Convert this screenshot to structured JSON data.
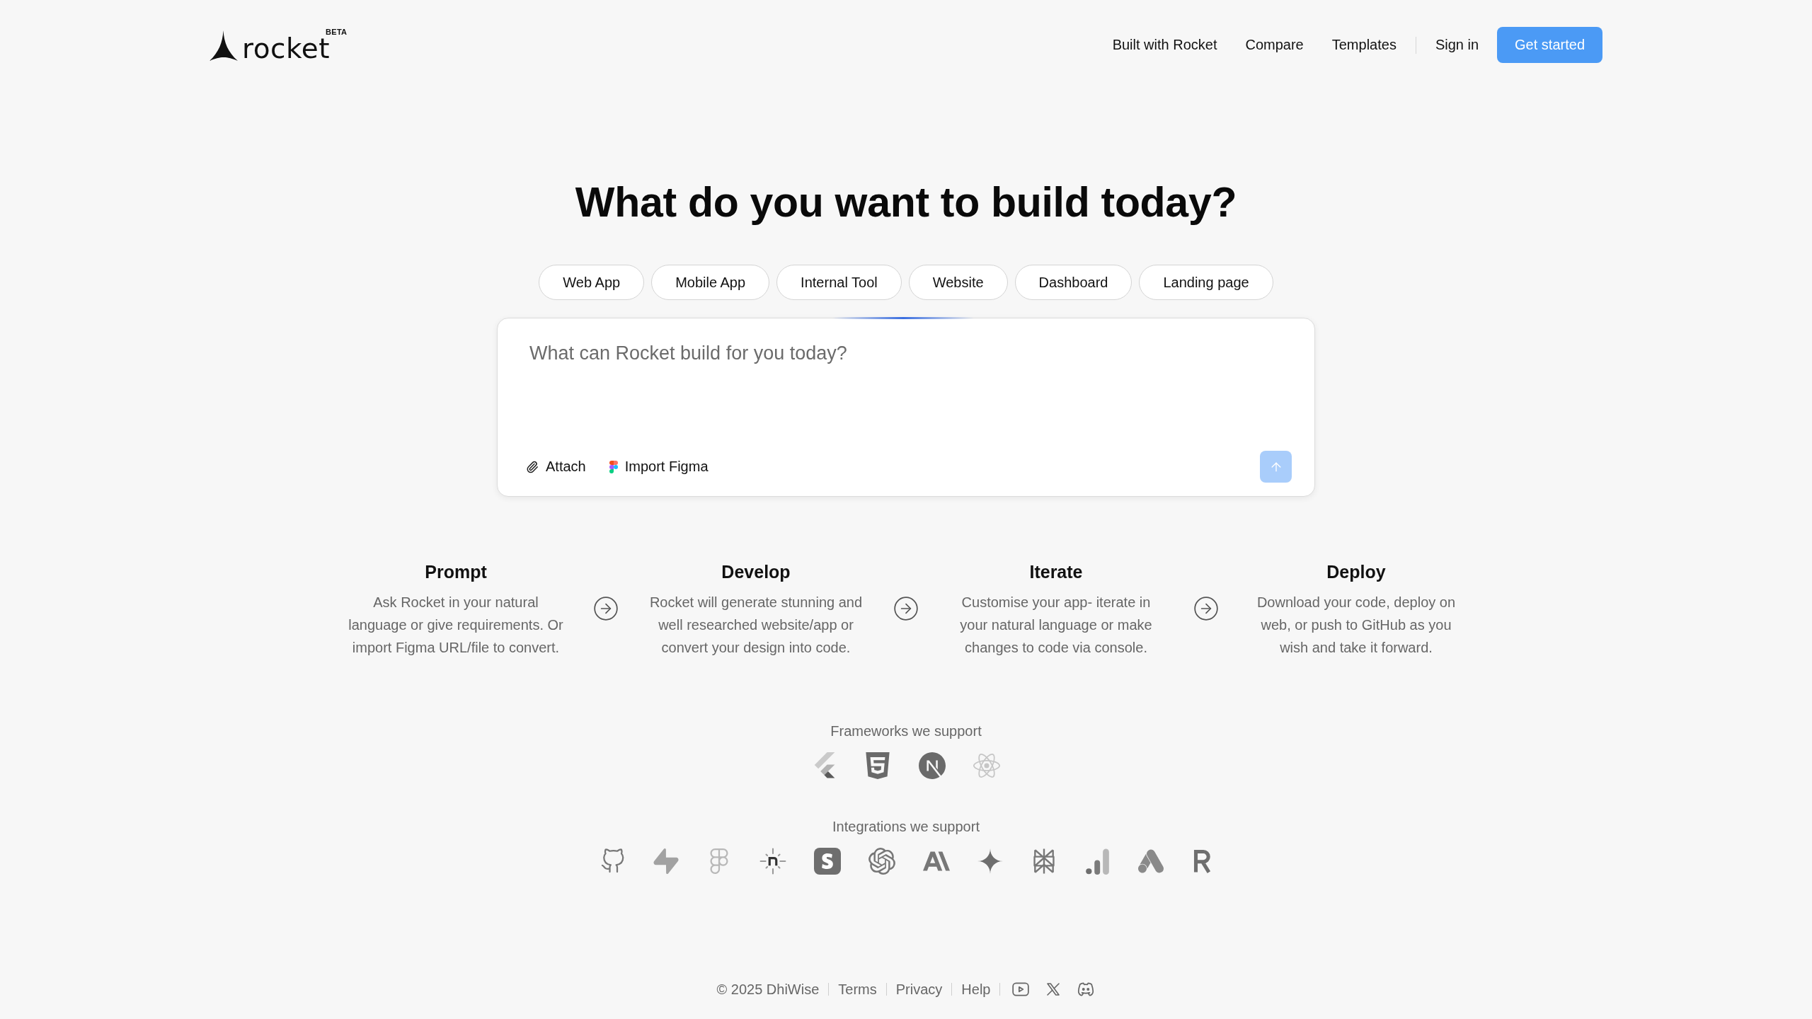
{
  "header": {
    "logo": {
      "wordmark": "rocket",
      "badge": "BETA"
    },
    "nav_links": [
      "Built with Rocket",
      "Compare",
      "Templates"
    ],
    "sign_in": "Sign in",
    "cta_button": "Get started"
  },
  "hero": {
    "title": "What do you want to build today?",
    "suggestions": [
      "Web App",
      "Mobile App",
      "Internal Tool",
      "Website",
      "Dashboard",
      "Landing page"
    ]
  },
  "prompt_box": {
    "placeholder": "What can Rocket build for you today?",
    "actions": [
      {
        "kind": "attach",
        "label": "Attach"
      },
      {
        "kind": "figma",
        "label": "Import Figma"
      }
    ],
    "send_button": {
      "disabled": true
    }
  },
  "steps": [
    {
      "title": "Prompt",
      "description": "Ask Rocket in your natural language or give requirements. Or import Figma URL/file to convert."
    },
    {
      "title": "Develop",
      "description": "Rocket will generate stunning and well researched website/app or convert your design into code."
    },
    {
      "title": "Iterate",
      "description": "Customise your app- iterate in your natural language or make changes to code via console."
    },
    {
      "title": "Deploy",
      "description": "Download your code, deploy on web, or push to GitHub as you wish and take it forward."
    }
  ],
  "frameworks": {
    "label": "Frameworks we support"
  },
  "integrations": {
    "label": "Integrations we support"
  },
  "footer": {
    "copyright": "© 2025 DhiWise",
    "links": [
      "Terms",
      "Privacy",
      "Help"
    ]
  }
}
